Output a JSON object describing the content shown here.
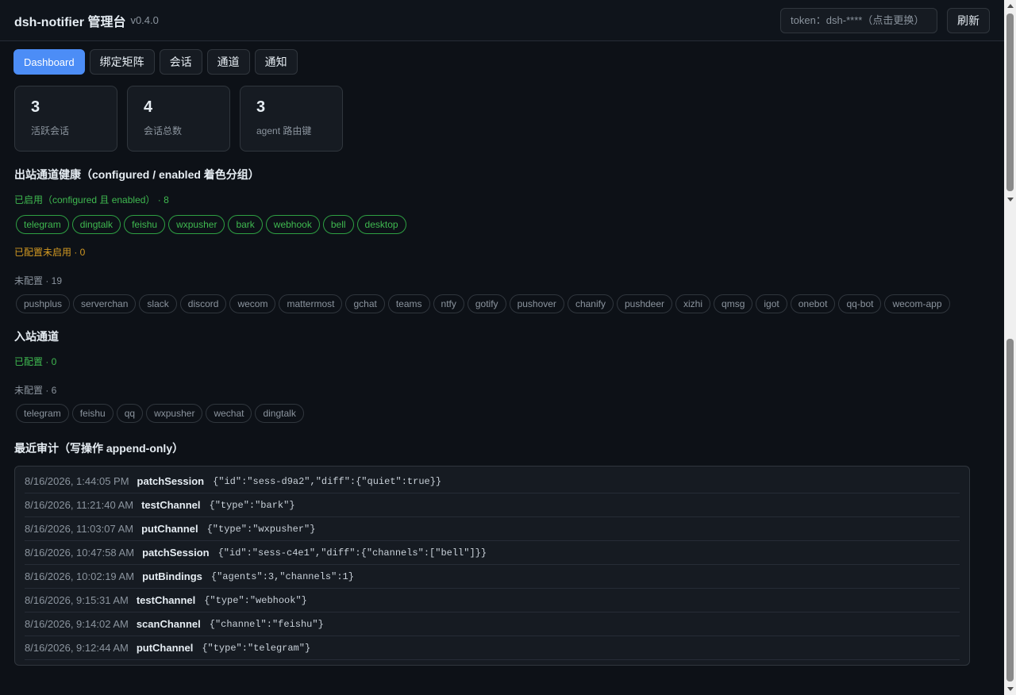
{
  "header": {
    "title": "dsh-notifier 管理台",
    "version": "v0.4.0",
    "token_placeholder": "token：dsh-****（点击更换）",
    "refresh_label": "刷新"
  },
  "tabs": [
    {
      "label": "Dashboard",
      "active": true
    },
    {
      "label": "绑定矩阵"
    },
    {
      "label": "会话"
    },
    {
      "label": "通道"
    },
    {
      "label": "通知"
    }
  ],
  "stats": [
    {
      "value": "3",
      "label": "活跃会话"
    },
    {
      "value": "4",
      "label": "会话总数"
    },
    {
      "value": "3",
      "label": "agent 路由键"
    }
  ],
  "outbound": {
    "title": "出站通道健康（configured / enabled 着色分组）",
    "enabled_label": "已启用（configured 且 enabled） · 8",
    "enabled": [
      "telegram",
      "dingtalk",
      "feishu",
      "wxpusher",
      "bark",
      "webhook",
      "bell",
      "desktop"
    ],
    "configured_disabled_label": "已配置未启用 · 0",
    "unconfigured_label": "未配置 · 19",
    "unconfigured": [
      "pushplus",
      "serverchan",
      "slack",
      "discord",
      "wecom",
      "mattermost",
      "gchat",
      "teams",
      "ntfy",
      "gotify",
      "pushover",
      "chanify",
      "pushdeer",
      "xizhi",
      "qmsg",
      "igot",
      "onebot",
      "qq-bot",
      "wecom-app"
    ]
  },
  "inbound": {
    "title": "入站通道",
    "configured_label": "已配置 · 0",
    "unconfigured_label": "未配置 · 6",
    "unconfigured": [
      "telegram",
      "feishu",
      "qq",
      "wxpusher",
      "wechat",
      "dingtalk"
    ]
  },
  "audit": {
    "title": "最近审计（写操作 append-only）",
    "rows": [
      {
        "time": "8/16/2026, 1:44:05 PM",
        "op": "patchSession",
        "payload": "{\"id\":\"sess-d9a2\",\"diff\":{\"quiet\":true}}"
      },
      {
        "time": "8/16/2026, 11:21:40 AM",
        "op": "testChannel",
        "payload": "{\"type\":\"bark\"}"
      },
      {
        "time": "8/16/2026, 11:03:07 AM",
        "op": "putChannel",
        "payload": "{\"type\":\"wxpusher\"}"
      },
      {
        "time": "8/16/2026, 10:47:58 AM",
        "op": "patchSession",
        "payload": "{\"id\":\"sess-c4e1\",\"diff\":{\"channels\":[\"bell\"]}}"
      },
      {
        "time": "8/16/2026, 10:02:19 AM",
        "op": "putBindings",
        "payload": "{\"agents\":3,\"channels\":1}"
      },
      {
        "time": "8/16/2026, 9:15:31 AM",
        "op": "testChannel",
        "payload": "{\"type\":\"webhook\"}"
      },
      {
        "time": "8/16/2026, 9:14:02 AM",
        "op": "scanChannel",
        "payload": "{\"channel\":\"feishu\"}"
      },
      {
        "time": "8/16/2026, 9:12:44 AM",
        "op": "putChannel",
        "payload": "{\"type\":\"telegram\"}"
      }
    ]
  },
  "colors": {
    "accent": "#4c8df6",
    "enabled": "#3fb950",
    "warning": "#d29922",
    "muted": "#8b949e",
    "background": "#0d1117"
  }
}
